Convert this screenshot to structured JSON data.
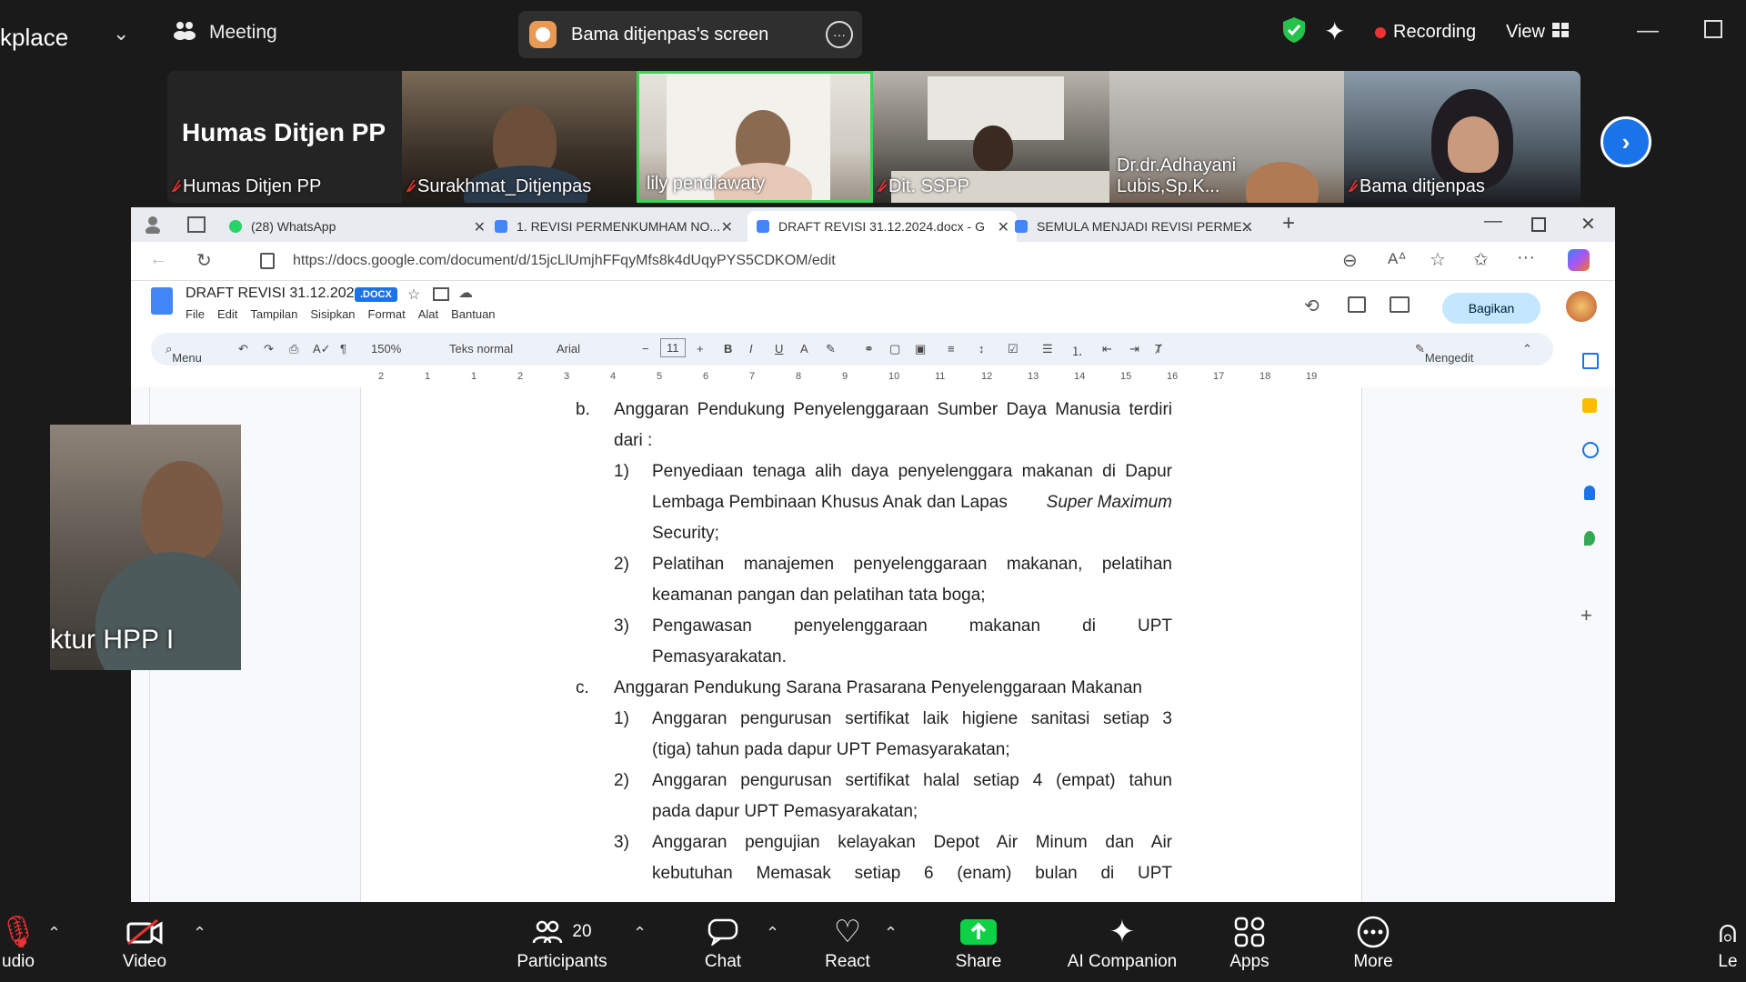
{
  "top_bar": {
    "app_name": "kplace",
    "meeting_label": "Meeting",
    "share_label": "Bama ditjenpas's screen",
    "recording_label": "Recording",
    "view_label": "View"
  },
  "participants": [
    {
      "name": "Humas Ditjen PP",
      "display": "Humas Ditjen PP"
    },
    {
      "name": "Surakhmat_Ditjenpas"
    },
    {
      "name": "lily pendiawaty"
    },
    {
      "name": "Dit. SSPP"
    },
    {
      "name": "Dr.dr.Adhayani Lubis,Sp.K..."
    },
    {
      "name": "Bama ditjenpas"
    }
  ],
  "self_view": {
    "name": "ktur HPP I"
  },
  "browser": {
    "tabs": [
      {
        "label": "(28) WhatsApp"
      },
      {
        "label": "1. REVISI PERMENKUMHAM NO..."
      },
      {
        "label": "DRAFT REVISI 31.12.2024.docx - G"
      },
      {
        "label": "SEMULA MENJADI REVISI PERME..."
      }
    ],
    "url": "https://docs.google.com/document/d/15jcLlUmjhFFqyMfs8k4dUqyPYS5CDKOM/edit"
  },
  "docs": {
    "title": "DRAFT REVISI 31.12.2024",
    "badge": ".DOCX",
    "menu": [
      "File",
      "Edit",
      "Tampilan",
      "Sisipkan",
      "Format",
      "Alat",
      "Bantuan"
    ],
    "share_label": "Bagikan",
    "toolbar": {
      "menu": "Menu",
      "zoom": "150%",
      "style": "Teks normal",
      "font": "Arial",
      "size": "11",
      "mode": "Mengedit"
    },
    "ruler": [
      "2",
      "1",
      "1",
      "2",
      "3",
      "4",
      "5",
      "6",
      "7",
      "8",
      "9",
      "10",
      "11",
      "12",
      "13",
      "14",
      "15",
      "16",
      "17",
      "18",
      "19"
    ]
  },
  "document_lines": [
    {
      "marker": "b.",
      "text": "Anggaran Pendukung Penyelenggaraan Sumber Daya Manusia terdiri"
    },
    {
      "text": "dari :"
    },
    {
      "marker": "1)",
      "text": "Penyediaan tenaga alih daya penyelenggara makanan di Dapur"
    },
    {
      "text": "Lembaga Pembinaan Khusus Anak dan Lapas",
      "italic": "Super Maximum"
    },
    {
      "text": "Security;"
    },
    {
      "marker": "2)",
      "text": "Pelatihan manajemen penyelenggaraan makanan, pelatihan"
    },
    {
      "text": "keamanan pangan dan pelatihan tata boga;"
    },
    {
      "marker": "3)",
      "text": "Pengawasan penyelenggaraan makanan di UPT"
    },
    {
      "text": "Pemasyarakatan."
    },
    {
      "marker": "c.",
      "text": "Anggaran Pendukung Sarana Prasarana Penyelenggaraan Makanan"
    },
    {
      "marker": "1)",
      "text": "Anggaran pengurusan sertifikat laik higiene sanitasi setiap 3"
    },
    {
      "text": "(tiga) tahun pada dapur UPT Pemasyarakatan;"
    },
    {
      "marker": "2)",
      "text": "Anggaran pengurusan sertifikat halal setiap 4 (empat) tahun"
    },
    {
      "text": "pada dapur UPT Pemasyarakatan;"
    },
    {
      "marker": "3)",
      "text": "Anggaran pengujian kelayakan Depot Air Minum dan Air"
    },
    {
      "text": "kebutuhan Memasak setiap 6 (enam) bulan di UPT"
    }
  ],
  "controls": {
    "audio": "udio",
    "video": "Video",
    "participants": "Participants",
    "participant_count": "20",
    "chat": "Chat",
    "react": "React",
    "share": "Share",
    "ai_companion": "AI Companion",
    "apps": "Apps",
    "more": "More",
    "leave": "Le"
  },
  "colors": {
    "accent": "#1a73e8",
    "recording": "#e33333",
    "active_speaker": "#39d353",
    "share_green": "#0ed145"
  }
}
